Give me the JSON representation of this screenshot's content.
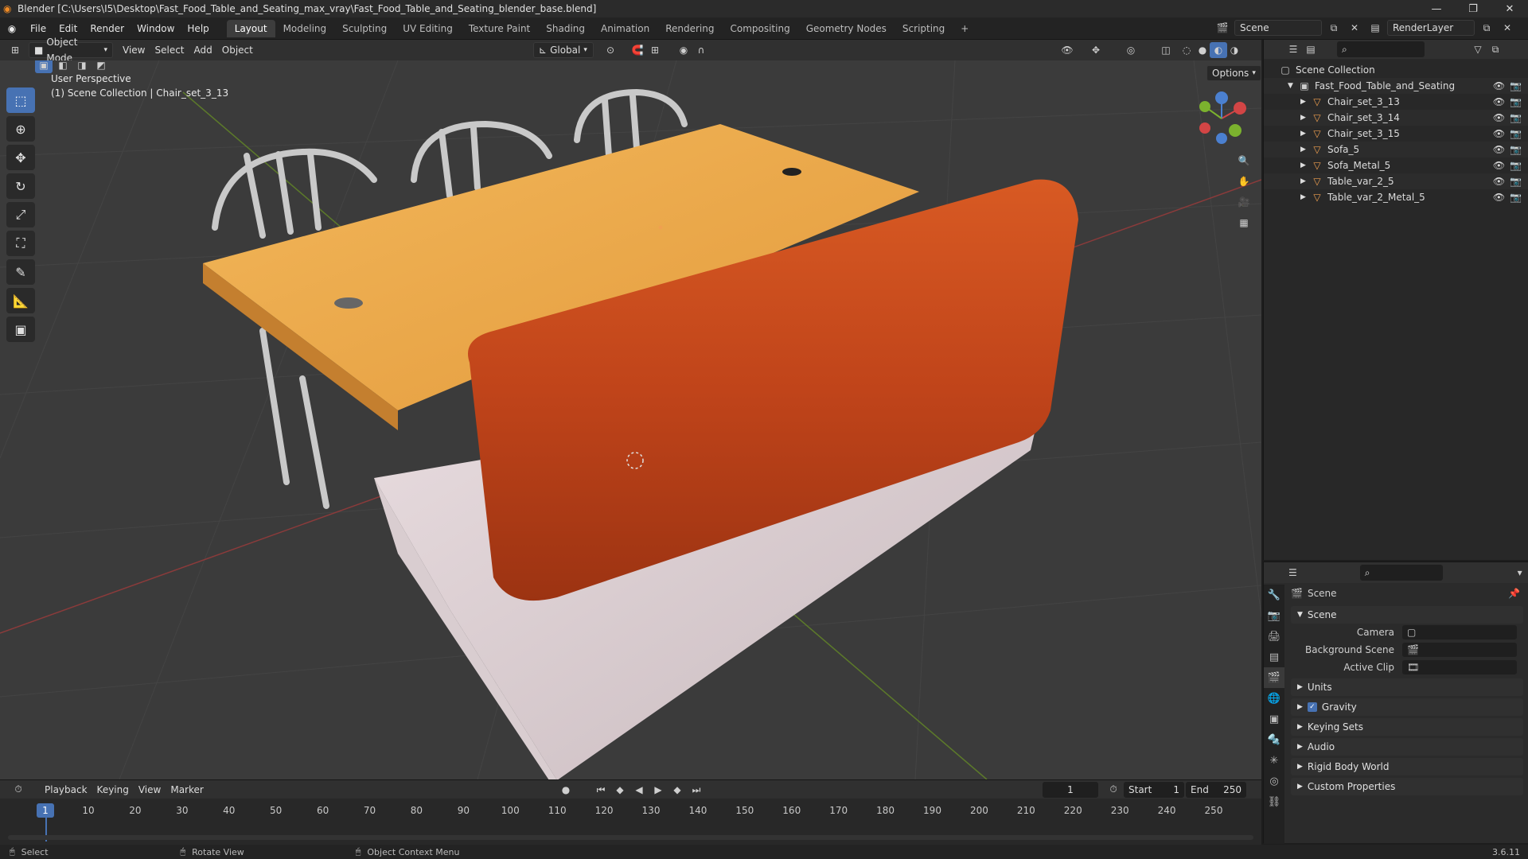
{
  "window": {
    "title": "Blender [C:\\Users\\I5\\Desktop\\Fast_Food_Table_and_Seating_max_vray\\Fast_Food_Table_and_Seating_blender_base.blend]"
  },
  "menu": [
    "File",
    "Edit",
    "Render",
    "Window",
    "Help"
  ],
  "workspaces": [
    "Layout",
    "Modeling",
    "Sculpting",
    "UV Editing",
    "Texture Paint",
    "Shading",
    "Animation",
    "Rendering",
    "Compositing",
    "Geometry Nodes",
    "Scripting"
  ],
  "active_workspace": "Layout",
  "scene_selector": "Scene",
  "view_layer": "RenderLayer",
  "viewport_header": {
    "mode": "Object Mode",
    "menus": [
      "View",
      "Select",
      "Add",
      "Object"
    ],
    "transform_orientation": "Global",
    "options_label": "Options"
  },
  "viewport": {
    "view_name": "User Perspective",
    "collection_info": "(1) Scene Collection | Chair_set_3_13"
  },
  "outliner": {
    "root": "Scene Collection",
    "collection": "Fast_Food_Table_and_Seating",
    "items": [
      "Chair_set_3_13",
      "Chair_set_3_14",
      "Chair_set_3_15",
      "Sofa_5",
      "Sofa_Metal_5",
      "Table_var_2_5",
      "Table_var_2_Metal_5"
    ]
  },
  "properties": {
    "context": "Scene",
    "panel_scene": "Scene",
    "camera_label": "Camera",
    "background_scene_label": "Background Scene",
    "active_clip_label": "Active Clip",
    "collapsed_panels": [
      "Units",
      "Gravity",
      "Keying Sets",
      "Audio",
      "Rigid Body World",
      "Custom Properties"
    ]
  },
  "timeline": {
    "menus": [
      "Playback",
      "Keying",
      "View",
      "Marker"
    ],
    "current_frame": "1",
    "start_label": "Start",
    "start": "1",
    "end_label": "End",
    "end": "250",
    "ticks": [
      "10",
      "20",
      "30",
      "40",
      "50",
      "60",
      "70",
      "80",
      "90",
      "100",
      "110",
      "120",
      "130",
      "140",
      "150",
      "160",
      "170",
      "180",
      "190",
      "200",
      "210",
      "220",
      "230",
      "240",
      "250"
    ]
  },
  "statusbar": {
    "select": "Select",
    "rotate": "Rotate View",
    "context_menu": "Object Context Menu",
    "version": "3.6.11"
  }
}
